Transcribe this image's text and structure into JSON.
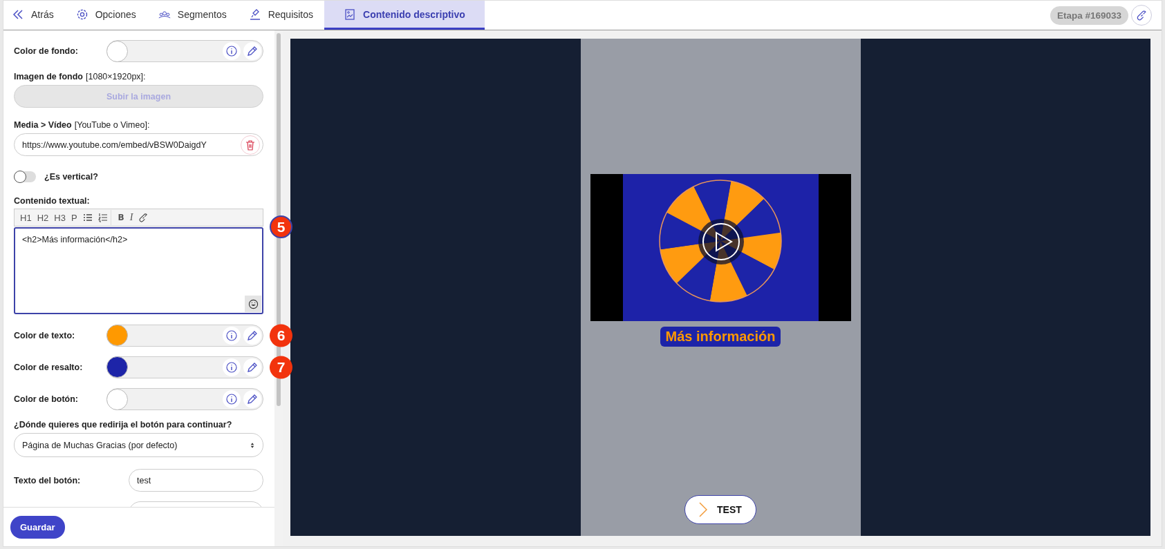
{
  "tabs": [
    {
      "label": "Atrás",
      "selected": false
    },
    {
      "label": "Opciones",
      "selected": false
    },
    {
      "label": "Segmentos",
      "selected": false
    },
    {
      "label": "Requisitos",
      "selected": false
    },
    {
      "label": "Contenido descriptivo",
      "selected": true
    }
  ],
  "stage_badge": "Etapa #169033",
  "fields": [
    {
      "kind": "color",
      "label": "Color de fondo:",
      "color": "#ffffff"
    },
    {
      "kind": "upload",
      "label": "Imagen de fondo",
      "hint": "[1080×1920px]:",
      "button": "Subir la imagen"
    },
    {
      "kind": "url",
      "label": "Media > Vídeo",
      "hint": "[YouTube o Vimeo]:",
      "value": "https://www.youtube.com/embed/vBSW0DaigdY"
    },
    {
      "kind": "toggle",
      "label": "¿Es vertical?",
      "on": false
    },
    {
      "kind": "editor",
      "label": "Contenido textual:",
      "value": "<h2>Más información</h2>",
      "annotation": "5",
      "toolbar": [
        {
          "kind": "text",
          "label": "H1"
        },
        {
          "kind": "text",
          "label": "H2"
        },
        {
          "kind": "text",
          "label": "H3"
        },
        {
          "kind": "text",
          "label": "P"
        },
        {
          "kind": "bullets"
        },
        {
          "kind": "numbers"
        },
        {
          "kind": "bold",
          "label": "B"
        },
        {
          "kind": "italic",
          "label": "I"
        },
        {
          "kind": "link"
        }
      ]
    },
    {
      "kind": "color",
      "label": "Color de texto:",
      "color": "#ff9900",
      "annotation": "6"
    },
    {
      "kind": "color",
      "label": "Color de resalto:",
      "color": "#1d24a8",
      "annotation": "7"
    },
    {
      "kind": "color",
      "label": "Color de botón:",
      "color": "#ffffff"
    },
    {
      "kind": "select",
      "label": "¿Dónde quieres que redirija el botón para continuar?",
      "value": "Página de Muchas Gracias (por defecto)"
    },
    {
      "kind": "text",
      "label": "Texto del botón:",
      "value": "test"
    },
    {
      "kind": "blank"
    }
  ],
  "save_button": "Guardar",
  "preview": {
    "heading": "Más información",
    "button": "TEST"
  }
}
